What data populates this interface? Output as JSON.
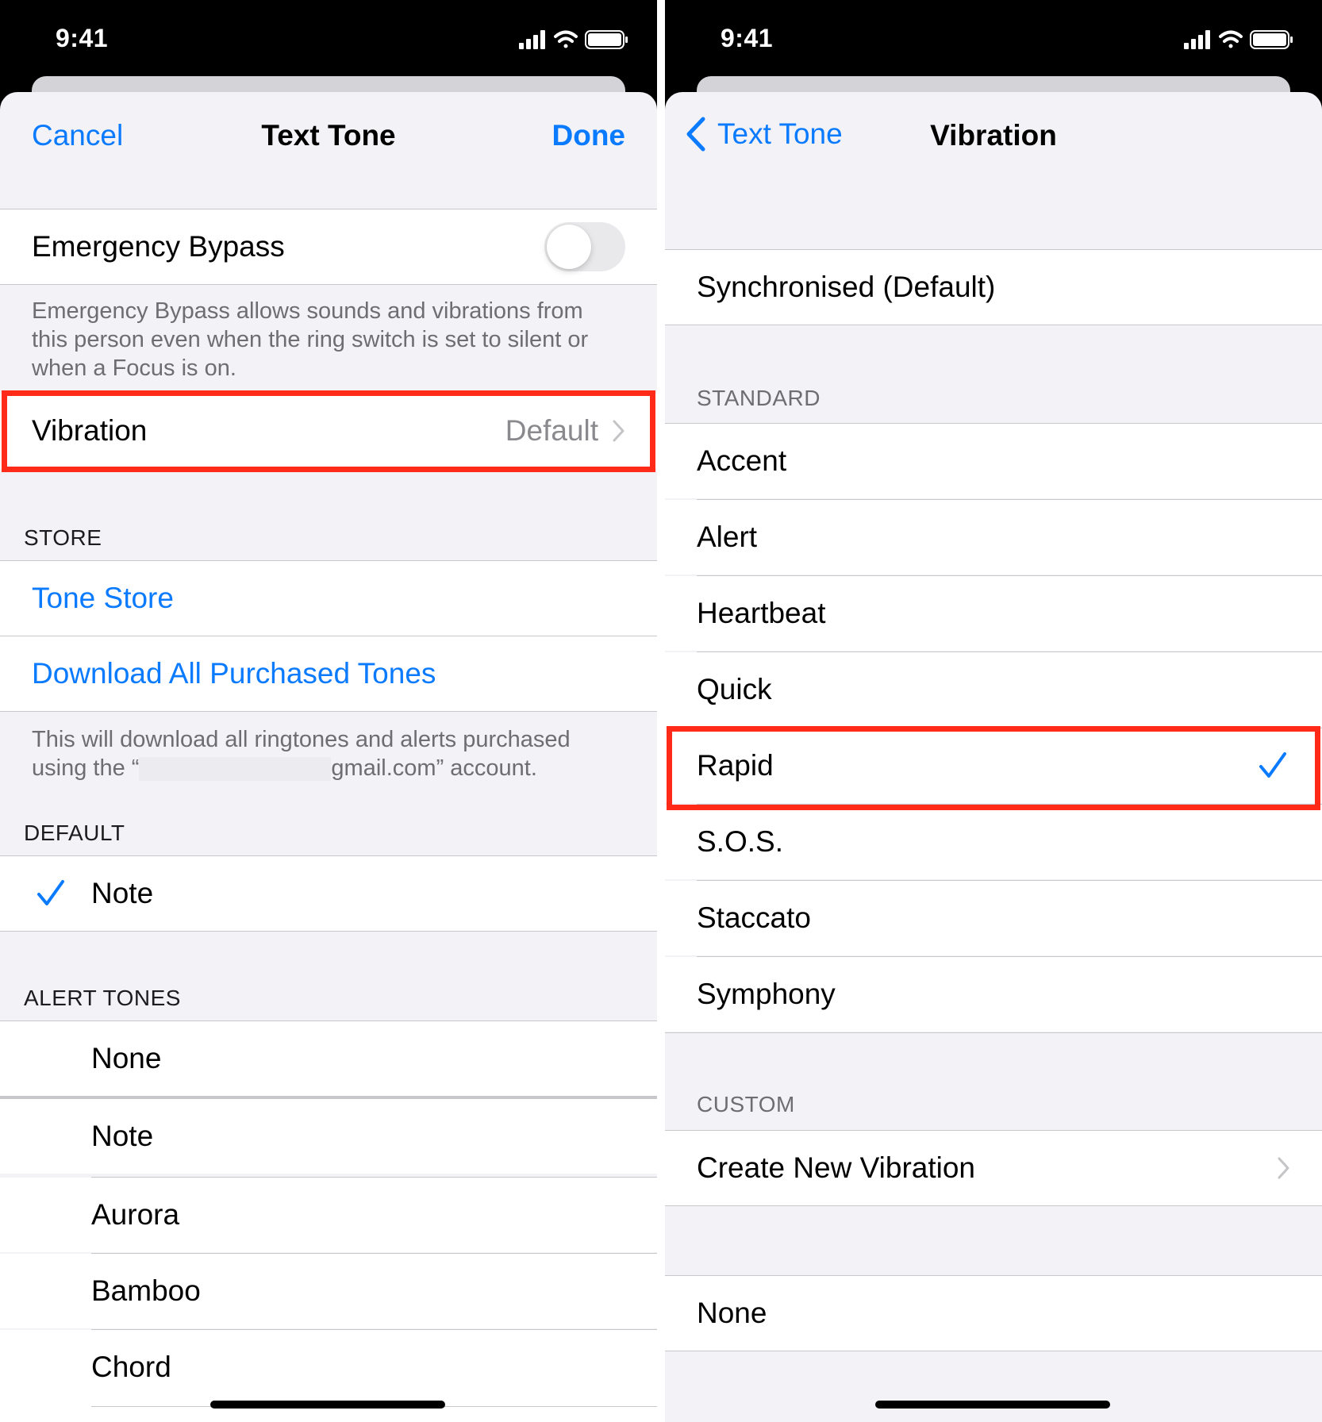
{
  "status": {
    "time": "9:41"
  },
  "left": {
    "nav": {
      "cancel": "Cancel",
      "title": "Text Tone",
      "done": "Done"
    },
    "emergency_bypass": {
      "label": "Emergency Bypass"
    },
    "emergency_footer": "Emergency Bypass allows sounds and vibrations from this person even when the ring switch is set to silent or when a Focus is on.",
    "vibration": {
      "label": "Vibration",
      "value": "Default"
    },
    "store_header": "STORE",
    "tone_store": "Tone Store",
    "download_all": "Download All Purchased Tones",
    "download_footer_pre": "This will download all ringtones and alerts purchased using the “",
    "download_footer_post": "gmail.com” account.",
    "default_header": "DEFAULT",
    "default_item": "Note",
    "alert_header": "ALERT TONES",
    "alert_items": [
      "None",
      "Note",
      "Aurora",
      "Bamboo",
      "Chord"
    ]
  },
  "right": {
    "nav": {
      "back": "Text Tone",
      "title": "Vibration"
    },
    "synchronised": "Synchronised (Default)",
    "standard_header": "STANDARD",
    "standard_items": [
      "Accent",
      "Alert",
      "Heartbeat",
      "Quick",
      "Rapid",
      "S.O.S.",
      "Staccato",
      "Symphony"
    ],
    "selected": "Rapid",
    "custom_header": "CUSTOM",
    "create_new": "Create New Vibration",
    "none": "None"
  },
  "colors": {
    "accent": "#0a7aff",
    "highlight": "#ff2a17"
  }
}
